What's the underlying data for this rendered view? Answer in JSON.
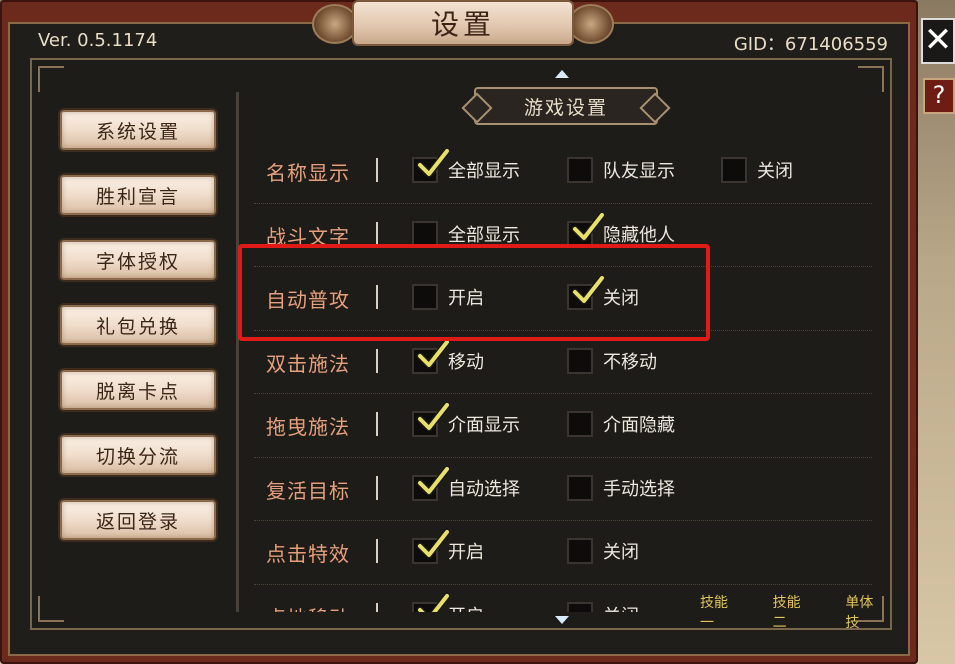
{
  "header": {
    "title": "设置",
    "version": "Ver. 0.5.1174",
    "gid": "GID：671406559"
  },
  "controls": {
    "close_symbol": "✕",
    "help_symbol": "?"
  },
  "sidebar": {
    "items": [
      {
        "label": "系统设置"
      },
      {
        "label": "胜利宣言"
      },
      {
        "label": "字体授权"
      },
      {
        "label": "礼包兑换"
      },
      {
        "label": "脱离卡点"
      },
      {
        "label": "切换分流"
      },
      {
        "label": "返回登录"
      }
    ]
  },
  "section": {
    "title": "游戏设置"
  },
  "settings": [
    {
      "label": "名称显示",
      "options": [
        {
          "label": "全部显示",
          "checked": true
        },
        {
          "label": "队友显示",
          "checked": false
        },
        {
          "label": "关闭",
          "checked": false
        }
      ]
    },
    {
      "label": "战斗文字",
      "options": [
        {
          "label": "全部显示",
          "checked": false
        },
        {
          "label": "隐藏他人",
          "checked": true
        }
      ]
    },
    {
      "label": "自动普攻",
      "options": [
        {
          "label": "开启",
          "checked": false
        },
        {
          "label": "关闭",
          "checked": true
        }
      ]
    },
    {
      "label": "双击施法",
      "options": [
        {
          "label": "移动",
          "checked": true
        },
        {
          "label": "不移动",
          "checked": false
        }
      ]
    },
    {
      "label": "拖曳施法",
      "options": [
        {
          "label": "介面显示",
          "checked": true
        },
        {
          "label": "介面隐藏",
          "checked": false
        }
      ]
    },
    {
      "label": "复活目标",
      "options": [
        {
          "label": "自动选择",
          "checked": true
        },
        {
          "label": "手动选择",
          "checked": false
        }
      ]
    },
    {
      "label": "点击特效",
      "options": [
        {
          "label": "开启",
          "checked": true
        },
        {
          "label": "关闭",
          "checked": false
        }
      ]
    },
    {
      "label": "点地移动",
      "options": [
        {
          "label": "开启",
          "checked": true
        },
        {
          "label": "关闭",
          "checked": false
        }
      ]
    }
  ],
  "skill_labels": [
    "技能一",
    "技能二",
    "单体技"
  ],
  "colors": {
    "highlight": "#e01a17",
    "label_orange": "#e7a07c",
    "check_yellow": "#e8e06a"
  }
}
